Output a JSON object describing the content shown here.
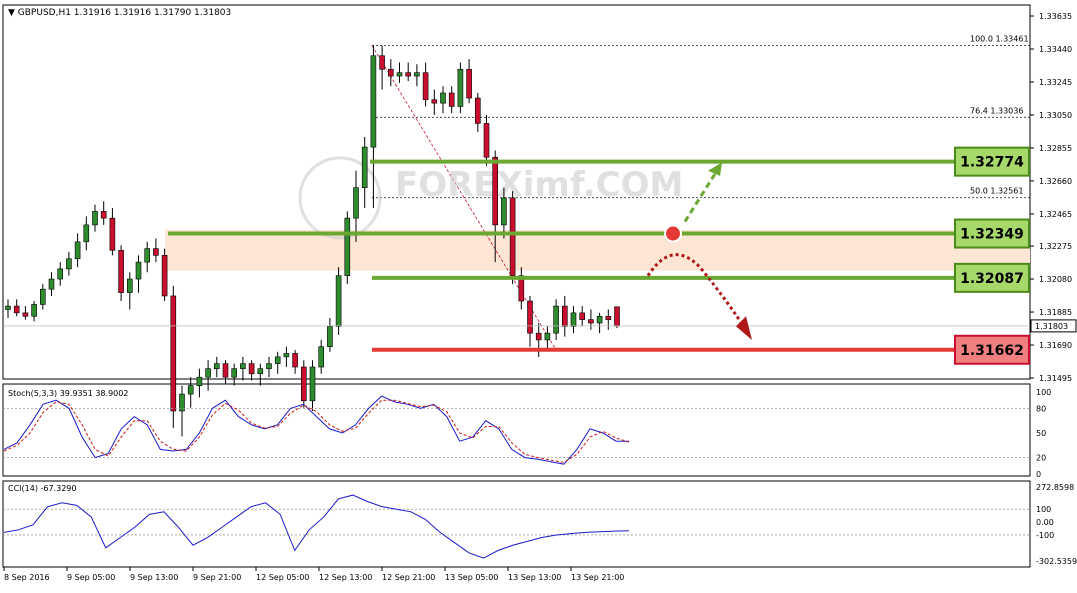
{
  "header": {
    "symbol_info": "GBPUSD,H1  1.31916 1.31916 1.31790 1.31803"
  },
  "chart_data": [
    {
      "type": "candlestick",
      "title": "GBPUSD,H1",
      "ohlc_text": "1.31916 1.31916 1.31790 1.31803",
      "ylim": [
        1.31495,
        1.33635
      ],
      "y_ticks": [
        "1.33635",
        "1.33440",
        "1.33245",
        "1.33050",
        "1.32855",
        "1.32660",
        "1.32465",
        "1.32275",
        "1.32080",
        "1.31885",
        "1.31690",
        "1.31495"
      ],
      "x_ticks": [
        "8 Sep 2016",
        "9 Sep 05:00",
        "9 Sep 13:00",
        "9 Sep 21:00",
        "12 Sep 05:00",
        "12 Sep 13:00",
        "12 Sep 21:00",
        "13 Sep 05:00",
        "13 Sep 13:00",
        "13 Sep 21:00"
      ],
      "current_price": "1.31803",
      "colors": {
        "bull": "#2e8b2e",
        "bear": "#c8102e",
        "level_green": "#6aa832",
        "level_red": "#e53935",
        "zone": "#fde6d4"
      },
      "fibonacci": [
        {
          "label": "100.0",
          "price": "1.33461"
        },
        {
          "label": "76.4",
          "price": "1.33036"
        },
        {
          "label": "50.0",
          "price": "1.32561"
        }
      ],
      "levels": [
        {
          "price": "1.32774",
          "type": "resistance"
        },
        {
          "price": "1.32349",
          "type": "resistance"
        },
        {
          "price": "1.32087",
          "type": "resistance"
        },
        {
          "price": "1.31662",
          "type": "support"
        }
      ],
      "watermark": "FOREXimf.COM",
      "candles": [
        [
          1.319,
          1.3196,
          1.3185,
          1.3192
        ],
        [
          1.3192,
          1.3196,
          1.3186,
          1.3188
        ],
        [
          1.3188,
          1.3192,
          1.3184,
          1.3186
        ],
        [
          1.3186,
          1.3195,
          1.3183,
          1.3193
        ],
        [
          1.3193,
          1.3205,
          1.319,
          1.3202
        ],
        [
          1.3202,
          1.3212,
          1.3198,
          1.3208
        ],
        [
          1.3208,
          1.3218,
          1.3204,
          1.3214
        ],
        [
          1.3214,
          1.3224,
          1.321,
          1.322
        ],
        [
          1.322,
          1.3235,
          1.3215,
          1.323
        ],
        [
          1.323,
          1.3245,
          1.3225,
          1.324
        ],
        [
          1.324,
          1.3252,
          1.3236,
          1.3248
        ],
        [
          1.3248,
          1.3254,
          1.324,
          1.3244
        ],
        [
          1.3244,
          1.325,
          1.3222,
          1.3225
        ],
        [
          1.3225,
          1.3228,
          1.3195,
          1.32
        ],
        [
          1.32,
          1.3212,
          1.319,
          1.3208
        ],
        [
          1.3208,
          1.3222,
          1.32,
          1.3218
        ],
        [
          1.3218,
          1.323,
          1.3212,
          1.3226
        ],
        [
          1.3226,
          1.3232,
          1.3218,
          1.3222
        ],
        [
          1.3222,
          1.3226,
          1.3195,
          1.3198
        ],
        [
          1.3198,
          1.3204,
          1.312,
          1.313
        ],
        [
          1.313,
          1.3145,
          1.3115,
          1.314
        ],
        [
          1.314,
          1.315,
          1.3132,
          1.3145
        ],
        [
          1.3145,
          1.3155,
          1.3138,
          1.315
        ],
        [
          1.315,
          1.316,
          1.3142,
          1.3155
        ],
        [
          1.3155,
          1.3162,
          1.315,
          1.3158
        ],
        [
          1.3158,
          1.316,
          1.3146,
          1.315
        ],
        [
          1.315,
          1.3158,
          1.3145,
          1.3155
        ],
        [
          1.3155,
          1.3162,
          1.3148,
          1.3158
        ],
        [
          1.3158,
          1.316,
          1.3148,
          1.3152
        ],
        [
          1.3152,
          1.3158,
          1.3145,
          1.3155
        ],
        [
          1.3155,
          1.3162,
          1.315,
          1.3158
        ],
        [
          1.3158,
          1.3165,
          1.3152,
          1.3162
        ],
        [
          1.3162,
          1.3168,
          1.3156,
          1.3164
        ],
        [
          1.3164,
          1.3166,
          1.3152,
          1.3156
        ],
        [
          1.3156,
          1.316,
          1.3132,
          1.3136
        ],
        [
          1.3136,
          1.316,
          1.313,
          1.3156
        ],
        [
          1.3156,
          1.3172,
          1.3152,
          1.3168
        ],
        [
          1.3168,
          1.3185,
          1.3165,
          1.318
        ],
        [
          1.318,
          1.3215,
          1.3175,
          1.321
        ],
        [
          1.321,
          1.3248,
          1.3205,
          1.3244
        ],
        [
          1.3244,
          1.3272,
          1.323,
          1.3262
        ],
        [
          1.3262,
          1.3292,
          1.325,
          1.3286
        ],
        [
          1.3286,
          1.33461,
          1.325,
          1.334
        ],
        [
          1.334,
          1.3346,
          1.332,
          1.3332
        ],
        [
          1.3332,
          1.3338,
          1.3322,
          1.3328
        ],
        [
          1.3328,
          1.3336,
          1.3324,
          1.333
        ],
        [
          1.333,
          1.3336,
          1.3325,
          1.3328
        ],
        [
          1.3328,
          1.3335,
          1.3322,
          1.333
        ],
        [
          1.333,
          1.3336,
          1.331,
          1.3314
        ],
        [
          1.3314,
          1.332,
          1.3305,
          1.3312
        ],
        [
          1.3312,
          1.3322,
          1.3306,
          1.3318
        ],
        [
          1.3318,
          1.3322,
          1.3306,
          1.331
        ],
        [
          1.331,
          1.3336,
          1.3306,
          1.3332
        ],
        [
          1.3332,
          1.3338,
          1.3312,
          1.3315
        ],
        [
          1.3315,
          1.3318,
          1.3295,
          1.33
        ],
        [
          1.33,
          1.3305,
          1.3275,
          1.328
        ],
        [
          1.328,
          1.3284,
          1.3218,
          1.324
        ],
        [
          1.324,
          1.3262,
          1.3232,
          1.3256
        ],
        [
          1.3256,
          1.326,
          1.3205,
          1.321
        ],
        [
          1.321,
          1.3215,
          1.319,
          1.3195
        ],
        [
          1.3195,
          1.3198,
          1.3168,
          1.3176
        ],
        [
          1.3176,
          1.3182,
          1.3162,
          1.3172
        ],
        [
          1.3172,
          1.318,
          1.3166,
          1.3176
        ],
        [
          1.3176,
          1.3196,
          1.3172,
          1.3192
        ],
        [
          1.3192,
          1.3198,
          1.3174,
          1.318
        ],
        [
          1.318,
          1.3192,
          1.3176,
          1.3188
        ],
        [
          1.3188,
          1.3192,
          1.318,
          1.3184
        ],
        [
          1.3184,
          1.319,
          1.3178,
          1.3182
        ],
        [
          1.3182,
          1.3188,
          1.3176,
          1.3186
        ],
        [
          1.3186,
          1.319,
          1.3178,
          1.3184
        ],
        [
          1.31916,
          1.31916,
          1.3179,
          1.31803
        ]
      ]
    },
    {
      "type": "line",
      "title": "Stoch(5,3,3) 39.9351 38.9002",
      "ylim": [
        0,
        100
      ],
      "y_ticks": [
        "100",
        "80",
        "50",
        "20",
        "0"
      ],
      "levels": [
        80,
        20
      ],
      "series": [
        {
          "name": "main",
          "color": "#1a1acc",
          "values": [
            30,
            38,
            60,
            85,
            90,
            80,
            45,
            20,
            25,
            55,
            70,
            60,
            30,
            28,
            30,
            50,
            80,
            90,
            70,
            60,
            55,
            60,
            80,
            85,
            70,
            55,
            50,
            60,
            80,
            95,
            88,
            85,
            80,
            85,
            70,
            40,
            45,
            65,
            55,
            30,
            20,
            18,
            15,
            12,
            30,
            55,
            50,
            40,
            39.9351
          ]
        },
        {
          "name": "signal",
          "color": "#cc1a1a",
          "values": [
            28,
            35,
            50,
            75,
            88,
            85,
            60,
            30,
            22,
            45,
            65,
            65,
            40,
            30,
            28,
            45,
            72,
            86,
            78,
            62,
            56,
            58,
            74,
            84,
            76,
            60,
            52,
            56,
            74,
            90,
            90,
            86,
            82,
            84,
            76,
            50,
            44,
            58,
            58,
            38,
            24,
            20,
            17,
            14,
            24,
            45,
            52,
            44,
            38.9002
          ]
        }
      ]
    },
    {
      "type": "line",
      "title": "CCI(14) -67.3290",
      "ylim": [
        -302.5359,
        272.8598
      ],
      "y_ticks": [
        "272.8598",
        "100",
        "0.00",
        "-100",
        "-302.5359"
      ],
      "series": [
        {
          "name": "CCI",
          "color": "#1a1acc",
          "values": [
            -80,
            -60,
            -20,
            120,
            150,
            130,
            40,
            -200,
            -120,
            -40,
            60,
            80,
            -40,
            -180,
            -120,
            -40,
            40,
            120,
            150,
            60,
            -220,
            -60,
            40,
            180,
            210,
            160,
            120,
            100,
            80,
            20,
            -80,
            -160,
            -240,
            -280,
            -220,
            -180,
            -150,
            -120,
            -100,
            -90,
            -80,
            -75,
            -70,
            -67.329
          ]
        }
      ]
    }
  ]
}
